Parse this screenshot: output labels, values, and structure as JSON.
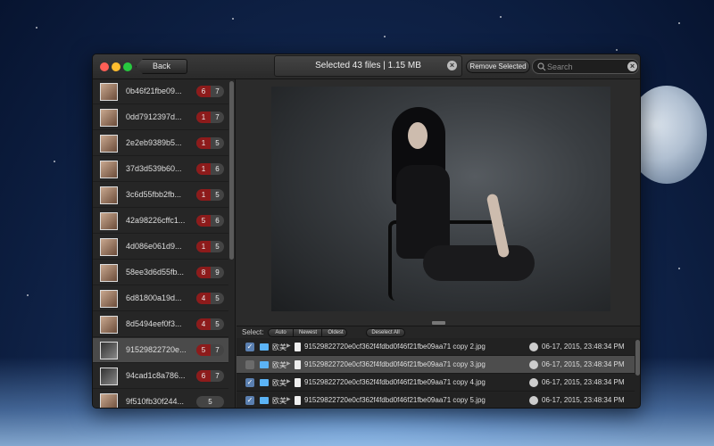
{
  "toolbar": {
    "back_label": "Back",
    "status": "Selected 43 files | 1.15 MB",
    "remove_label": "Remove Selected",
    "search_placeholder": "Search"
  },
  "sidebar": {
    "items": [
      {
        "name": "0b46f21fbe09...",
        "dups": "6",
        "total": "7"
      },
      {
        "name": "0dd7912397d...",
        "dups": "1",
        "total": "7"
      },
      {
        "name": "2e2eb9389b5...",
        "dups": "1",
        "total": "5"
      },
      {
        "name": "37d3d539b60...",
        "dups": "1",
        "total": "6"
      },
      {
        "name": "3c6d55fbb2fb...",
        "dups": "1",
        "total": "5"
      },
      {
        "name": "42a98226cffc1...",
        "dups": "5",
        "total": "6"
      },
      {
        "name": "4d086e061d9...",
        "dups": "1",
        "total": "5"
      },
      {
        "name": "58ee3d6d55fb...",
        "dups": "8",
        "total": "9"
      },
      {
        "name": "6d81800a19d...",
        "dups": "4",
        "total": "5"
      },
      {
        "name": "8d5494eef0f3...",
        "dups": "4",
        "total": "5"
      },
      {
        "name": "91529822720e...",
        "dups": "5",
        "total": "7"
      },
      {
        "name": "94cad1c8a786...",
        "dups": "6",
        "total": "7"
      },
      {
        "name": "9f510fb30f244...",
        "dups": "",
        "total": "5"
      }
    ]
  },
  "select_bar": {
    "label": "Select:",
    "auto": "Auto",
    "newest": "Newest",
    "oldest": "Oldest",
    "deselect_all": "Deselect All"
  },
  "files": [
    {
      "folder": "欧美",
      "name": "91529822720e0cf362f4fdbd0f46f21fbe09aa71 copy 2.jpg",
      "date": "06-17, 2015, 23:48:34 PM",
      "checked": "✓"
    },
    {
      "folder": "欧美",
      "name": "91529822720e0cf362f4fdbd0f46f21fbe09aa71 copy 3.jpg",
      "date": "06-17, 2015, 23:48:34 PM",
      "checked": ""
    },
    {
      "folder": "欧美",
      "name": "91529822720e0cf362f4fdbd0f46f21fbe09aa71 copy 4.jpg",
      "date": "06-17, 2015, 23:48:34 PM",
      "checked": "✓"
    },
    {
      "folder": "欧美",
      "name": "91529822720e0cf362f4fdbd0f46f21fbe09aa71 copy 5.jpg",
      "date": "06-17, 2015, 23:48:34 PM",
      "checked": "✓"
    }
  ]
}
